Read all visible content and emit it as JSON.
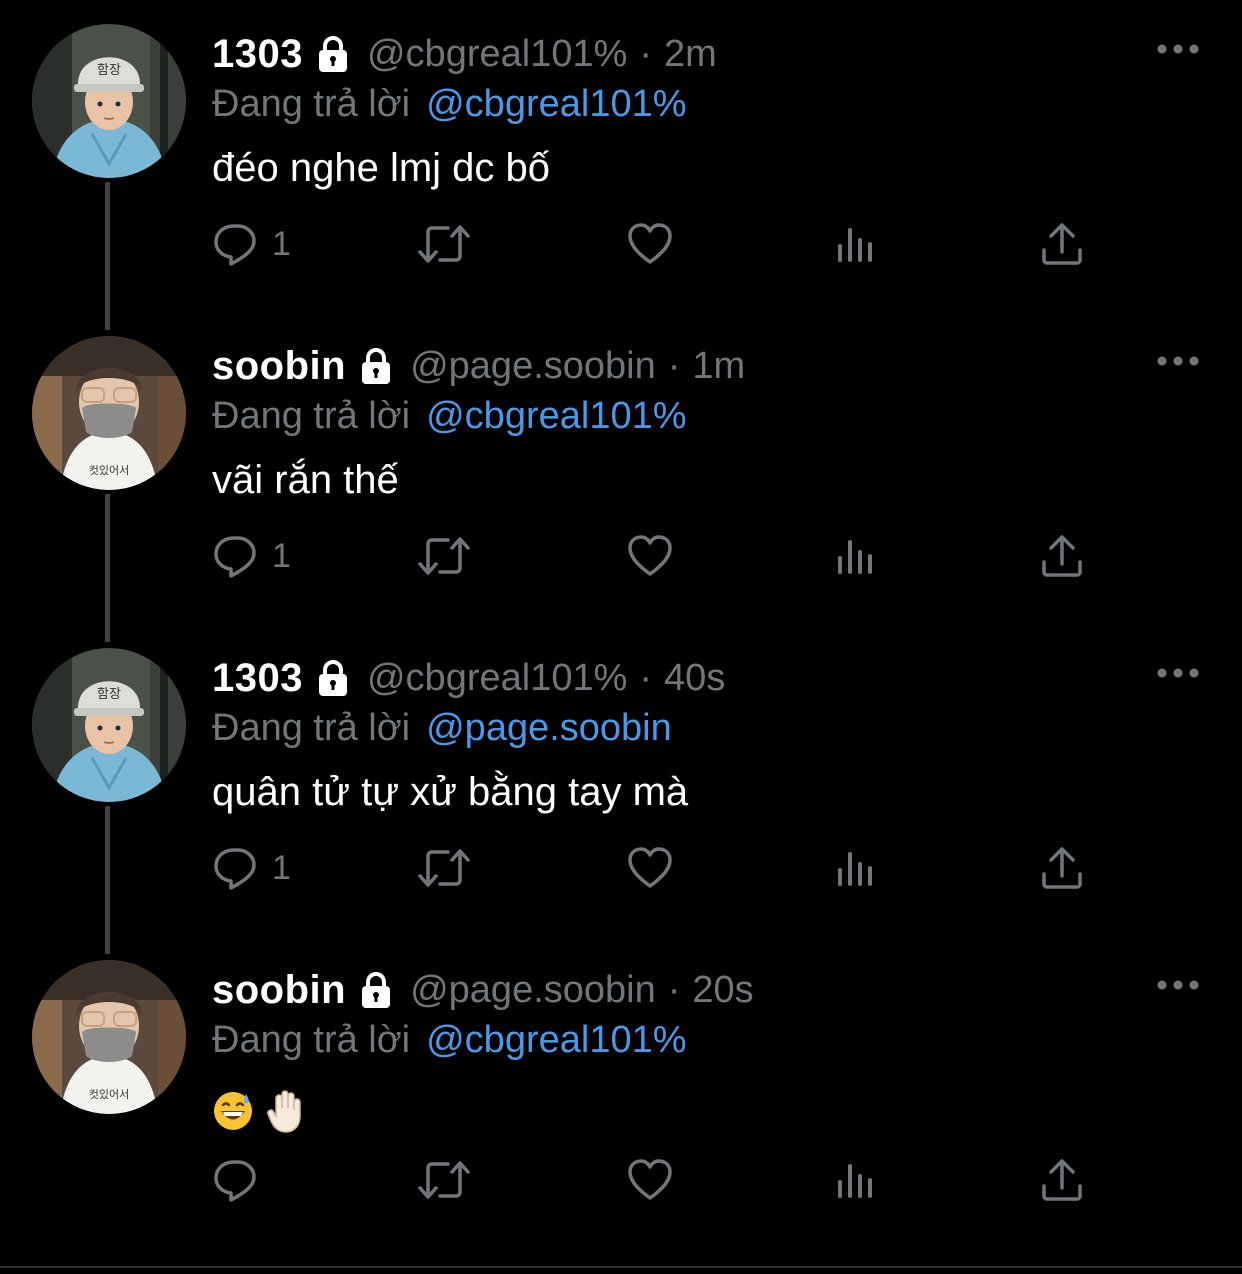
{
  "tweets": [
    {
      "display_name": "1303",
      "handle": "@cbgreal101%",
      "separator": "·",
      "time": "2m",
      "reply_prefix": "Đang trả lời",
      "reply_target": "@cbgreal101%",
      "text": "đéo nghe lmj dc bố",
      "reply_count": "1",
      "avatar": "avatar-boy-helmet"
    },
    {
      "display_name": "soobin",
      "handle": "@page.soobin",
      "separator": "·",
      "time": "1m",
      "reply_prefix": "Đang trả lời",
      "reply_target": "@cbgreal101%",
      "text": "vãi rắn thế",
      "reply_count": "1",
      "avatar": "avatar-masked-person"
    },
    {
      "display_name": "1303",
      "handle": "@cbgreal101%",
      "separator": "·",
      "time": "40s",
      "reply_prefix": "Đang trả lời",
      "reply_target": "@page.soobin",
      "text": "quân tử tự xử bằng tay mà",
      "reply_count": "1",
      "avatar": "avatar-boy-helmet"
    },
    {
      "display_name": "soobin",
      "handle": "@page.soobin",
      "separator": "·",
      "time": "20s",
      "reply_prefix": "Đang trả lời",
      "reply_target": "@cbgreal101%",
      "text": "",
      "emojis": [
        "grinning-sweat-emoji",
        "raised-hand-emoji"
      ],
      "reply_count": "",
      "avatar": "avatar-masked-person"
    }
  ],
  "colors": {
    "background": "#000000",
    "text": "#ffffff",
    "muted": "#71767b",
    "link": "#4a98e8",
    "thread_line": "#3e4144"
  },
  "icons": [
    "lock-icon",
    "more-icon",
    "reply-icon",
    "retweet-icon",
    "like-icon",
    "views-icon",
    "share-icon"
  ]
}
